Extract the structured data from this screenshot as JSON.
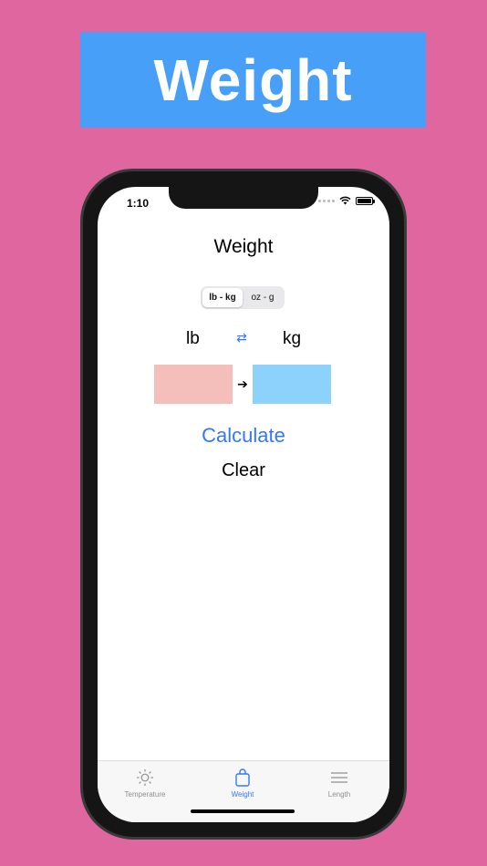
{
  "banner": {
    "title": "Weight"
  },
  "status": {
    "time": "1:10"
  },
  "page": {
    "title": "Weight"
  },
  "segmented": {
    "options": [
      "lb - kg",
      "oz - g"
    ],
    "selected": "lb - kg"
  },
  "converter": {
    "from_unit": "lb",
    "to_unit": "kg",
    "input_value": "",
    "output_value": ""
  },
  "actions": {
    "calculate_label": "Calculate",
    "clear_label": "Clear"
  },
  "tabbar": {
    "items": [
      {
        "label": "Temperature",
        "icon": "sun-icon"
      },
      {
        "label": "Weight",
        "icon": "bag-icon",
        "active": true
      },
      {
        "label": "Length",
        "icon": "lines-icon"
      }
    ]
  },
  "colors": {
    "background": "#e066a0",
    "banner": "#489ff8",
    "accent": "#3478f6",
    "input_fill": "#f4bfbb",
    "output_fill": "#8dd2fc"
  }
}
